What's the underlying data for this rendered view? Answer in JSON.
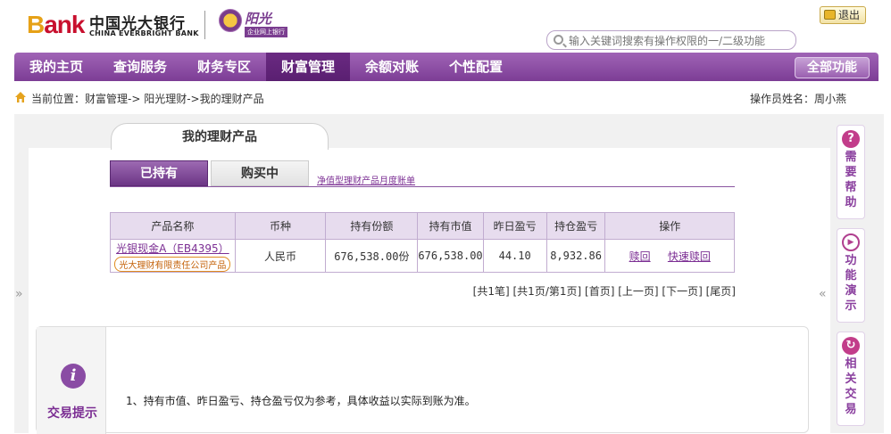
{
  "header": {
    "logo_bank_b": "B",
    "logo_bank_rest": "ank",
    "logo_cn": "中国光大银行",
    "logo_en": "CHINA EVERBRIGHT BANK",
    "sun_brand": "阳光",
    "sun_sub": "企业网上银行",
    "logout_label": "退出",
    "search_placeholder": "输入关键词搜索有操作权限的一/二级功能"
  },
  "nav": {
    "items": [
      "我的主页",
      "查询服务",
      "财务专区",
      "财富管理",
      "余额对账",
      "个性配置"
    ],
    "active": "财富管理",
    "all_functions": "全部功能"
  },
  "breadcrumb": {
    "text": "当前位置：财富管理-> 阳光理财->我的理财产品",
    "operator": "操作员姓名：周小燕"
  },
  "page": {
    "main_tab": "我的理财产品",
    "subtabs": [
      "已持有",
      "购买中"
    ],
    "statement_link": "净值型理财产品月度账单"
  },
  "table": {
    "headers": [
      "产品名称",
      "币种",
      "持有份额",
      "持有市值",
      "昨日盈亏",
      "持仓盈亏",
      "操作"
    ],
    "rows": [
      {
        "product_name": "光银现金A（EB4395）",
        "issuer": "光大理财有限责任公司产品",
        "currency": "人民币",
        "shares": "676,538.00份",
        "market_value": "676,538.00",
        "yesterday_pnl": "44.10",
        "position_pnl": "8,932.86",
        "actions": [
          "赎回",
          "快速赎回"
        ]
      }
    ]
  },
  "pager": {
    "total": "[共1笔]",
    "pages": "[共1页/第1页]",
    "first": "[首页]",
    "prev": "[上一页]",
    "next": "[下一页]",
    "last": "[尾页]"
  },
  "tips": {
    "label": "交易提示",
    "text": "1、持有市值、昨日盈亏、持仓盈亏仅为参考，具体收益以实际到账为准。"
  },
  "rail": {
    "help": "需要帮助",
    "demo": "功能演示",
    "related": "相关交易"
  },
  "colors": {
    "brand_purple": "#7c3d95",
    "link_purple": "#7b2e93",
    "bank_red": "#c8102e"
  }
}
